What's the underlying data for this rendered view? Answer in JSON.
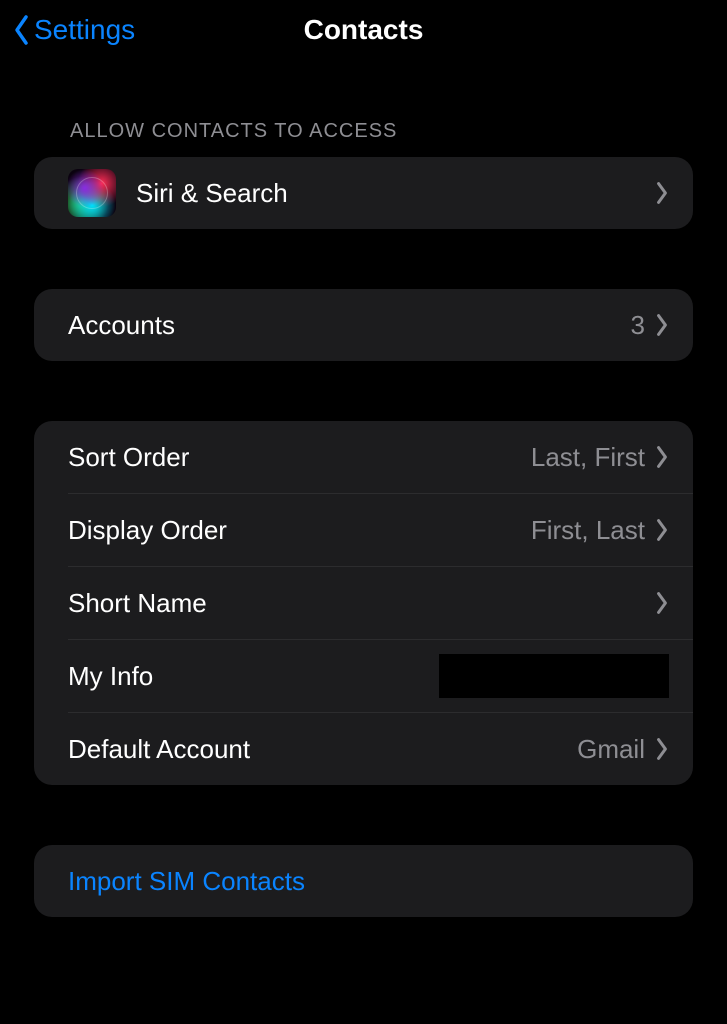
{
  "nav": {
    "back_label": "Settings",
    "title": "Contacts"
  },
  "section_header": "ALLOW CONTACTS TO ACCESS",
  "siri_row": {
    "label": "Siri & Search"
  },
  "accounts_row": {
    "label": "Accounts",
    "value": "3"
  },
  "prefs": {
    "sort_order": {
      "label": "Sort Order",
      "value": "Last, First"
    },
    "display_order": {
      "label": "Display Order",
      "value": "First, Last"
    },
    "short_name": {
      "label": "Short Name"
    },
    "my_info": {
      "label": "My Info"
    },
    "default_account": {
      "label": "Default Account",
      "value": "Gmail"
    }
  },
  "import_row": {
    "label": "Import SIM Contacts"
  }
}
